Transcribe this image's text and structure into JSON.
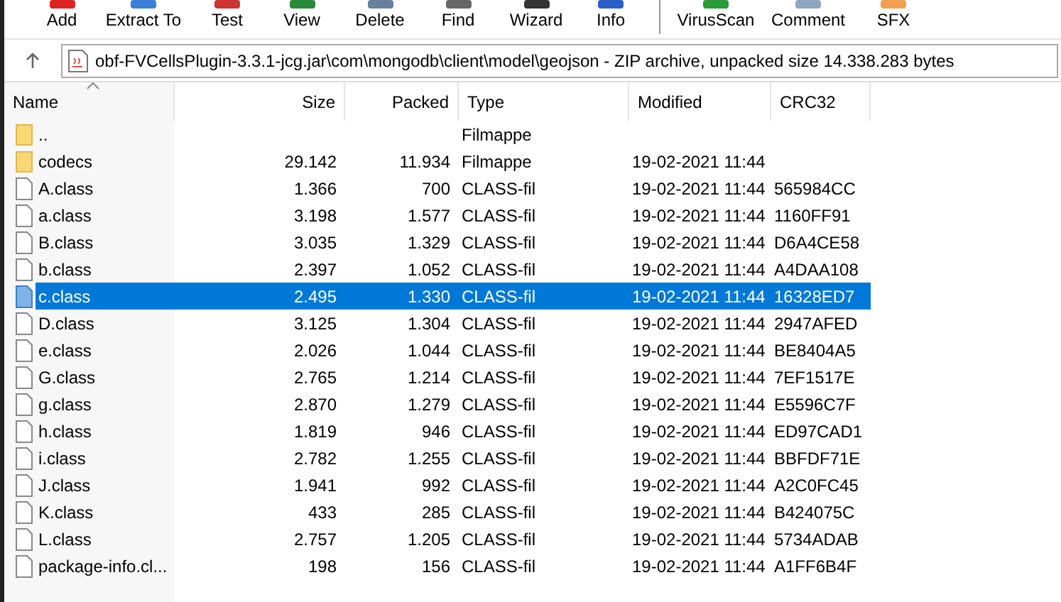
{
  "toolbar": [
    {
      "label": "Add"
    },
    {
      "label": "Extract To"
    },
    {
      "label": "Test"
    },
    {
      "label": "View"
    },
    {
      "label": "Delete"
    },
    {
      "label": "Find"
    },
    {
      "label": "Wizard"
    },
    {
      "label": "Info"
    },
    {
      "label": "VirusScan"
    },
    {
      "label": "Comment"
    },
    {
      "label": "SFX"
    }
  ],
  "address": {
    "path": "obf-FVCellsPlugin-3.3.1-jcg.jar\\com\\mongodb\\client\\model\\geojson - ZIP archive, unpacked size 14.338.283 bytes"
  },
  "table": {
    "columns": [
      "Name",
      "Size",
      "Packed",
      "Type",
      "Modified",
      "CRC32"
    ],
    "rows": [
      {
        "kind": "folder",
        "name": "..",
        "size": "",
        "packed": "",
        "type": "Filmappe",
        "modified": "",
        "crc32": "",
        "selected": false
      },
      {
        "kind": "folder",
        "name": "codecs",
        "size": "29.142",
        "packed": "11.934",
        "type": "Filmappe",
        "modified": "19-02-2021 11:44",
        "crc32": "",
        "selected": false
      },
      {
        "kind": "file",
        "name": "A.class",
        "size": "1.366",
        "packed": "700",
        "type": "CLASS-fil",
        "modified": "19-02-2021 11:44",
        "crc32": "565984CC",
        "selected": false
      },
      {
        "kind": "file",
        "name": "a.class",
        "size": "3.198",
        "packed": "1.577",
        "type": "CLASS-fil",
        "modified": "19-02-2021 11:44",
        "crc32": "1160FF91",
        "selected": false
      },
      {
        "kind": "file",
        "name": "B.class",
        "size": "3.035",
        "packed": "1.329",
        "type": "CLASS-fil",
        "modified": "19-02-2021 11:44",
        "crc32": "D6A4CE58",
        "selected": false
      },
      {
        "kind": "file",
        "name": "b.class",
        "size": "2.397",
        "packed": "1.052",
        "type": "CLASS-fil",
        "modified": "19-02-2021 11:44",
        "crc32": "A4DAA108",
        "selected": false
      },
      {
        "kind": "file",
        "name": "c.class",
        "size": "2.495",
        "packed": "1.330",
        "type": "CLASS-fil",
        "modified": "19-02-2021 11:44",
        "crc32": "16328ED7",
        "selected": true
      },
      {
        "kind": "file",
        "name": "D.class",
        "size": "3.125",
        "packed": "1.304",
        "type": "CLASS-fil",
        "modified": "19-02-2021 11:44",
        "crc32": "2947AFED",
        "selected": false
      },
      {
        "kind": "file",
        "name": "e.class",
        "size": "2.026",
        "packed": "1.044",
        "type": "CLASS-fil",
        "modified": "19-02-2021 11:44",
        "crc32": "BE8404A5",
        "selected": false
      },
      {
        "kind": "file",
        "name": "G.class",
        "size": "2.765",
        "packed": "1.214",
        "type": "CLASS-fil",
        "modified": "19-02-2021 11:44",
        "crc32": "7EF1517E",
        "selected": false
      },
      {
        "kind": "file",
        "name": "g.class",
        "size": "2.870",
        "packed": "1.279",
        "type": "CLASS-fil",
        "modified": "19-02-2021 11:44",
        "crc32": "E5596C7F",
        "selected": false
      },
      {
        "kind": "file",
        "name": "h.class",
        "size": "1.819",
        "packed": "946",
        "type": "CLASS-fil",
        "modified": "19-02-2021 11:44",
        "crc32": "ED97CAD1",
        "selected": false
      },
      {
        "kind": "file",
        "name": "i.class",
        "size": "2.782",
        "packed": "1.255",
        "type": "CLASS-fil",
        "modified": "19-02-2021 11:44",
        "crc32": "BBFDF71E",
        "selected": false
      },
      {
        "kind": "file",
        "name": "J.class",
        "size": "1.941",
        "packed": "992",
        "type": "CLASS-fil",
        "modified": "19-02-2021 11:44",
        "crc32": "A2C0FC45",
        "selected": false
      },
      {
        "kind": "file",
        "name": "K.class",
        "size": "433",
        "packed": "285",
        "type": "CLASS-fil",
        "modified": "19-02-2021 11:44",
        "crc32": "B424075C",
        "selected": false
      },
      {
        "kind": "file",
        "name": "L.class",
        "size": "2.757",
        "packed": "1.205",
        "type": "CLASS-fil",
        "modified": "19-02-2021 11:44",
        "crc32": "5734ADAB",
        "selected": false
      },
      {
        "kind": "file",
        "name": "package-info.cl...",
        "size": "198",
        "packed": "156",
        "type": "CLASS-fil",
        "modified": "19-02-2021 11:44",
        "crc32": "A1FF6B4F",
        "selected": false
      }
    ]
  }
}
